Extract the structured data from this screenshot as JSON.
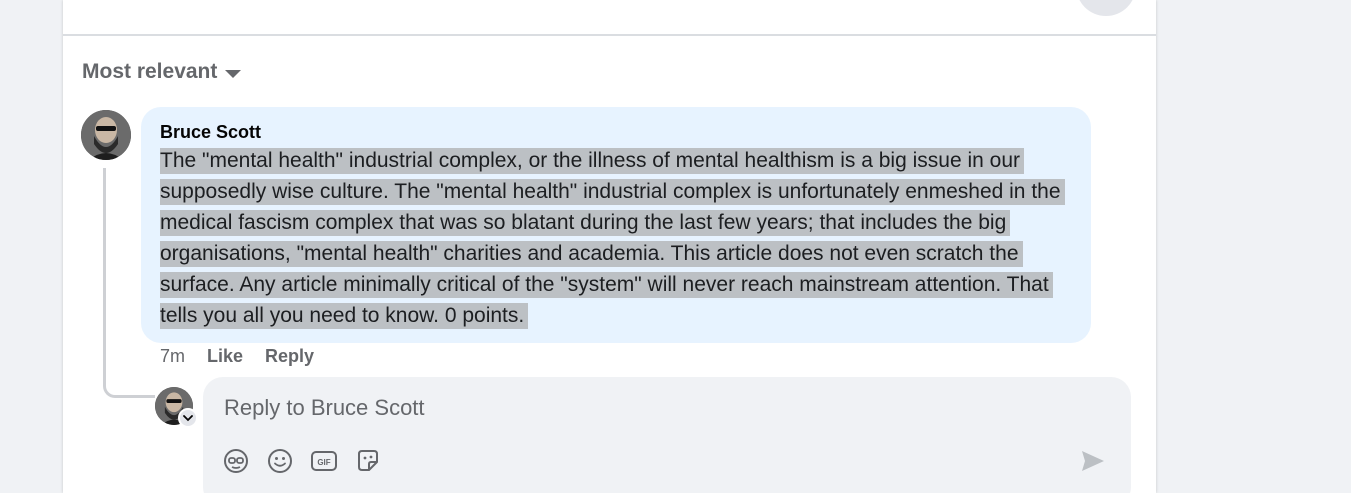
{
  "comments": {
    "sort_label": "Most relevant",
    "comment": {
      "author": "Bruce Scott",
      "text": "The \"mental health\" industrial complex, or the illness of mental healthism is a big issue in our supposedly wise culture. The \"mental health\" industrial complex is unfortunately enmeshed in the medical fascism complex that was so blatant during the last few years; that includes the big organisations, \"mental health\" charities and academia. This article does not even scratch the surface. Any article minimally critical of the \"system\" will never reach mainstream attention. That tells you all you need to know. 0 points.",
      "timestamp": "7m",
      "like_label": "Like",
      "reply_label": "Reply"
    },
    "composer": {
      "placeholder": "Reply to Bruce Scott",
      "icons": [
        "avatar-sticker-icon",
        "emoji-icon",
        "gif-icon",
        "sticker-icon",
        "send-icon"
      ]
    }
  },
  "colors": {
    "page_bg": "#f0f2f5",
    "bubble_bg": "#e7f3ff",
    "selection": "#bcc0c4",
    "secondary_text": "#65676b"
  }
}
